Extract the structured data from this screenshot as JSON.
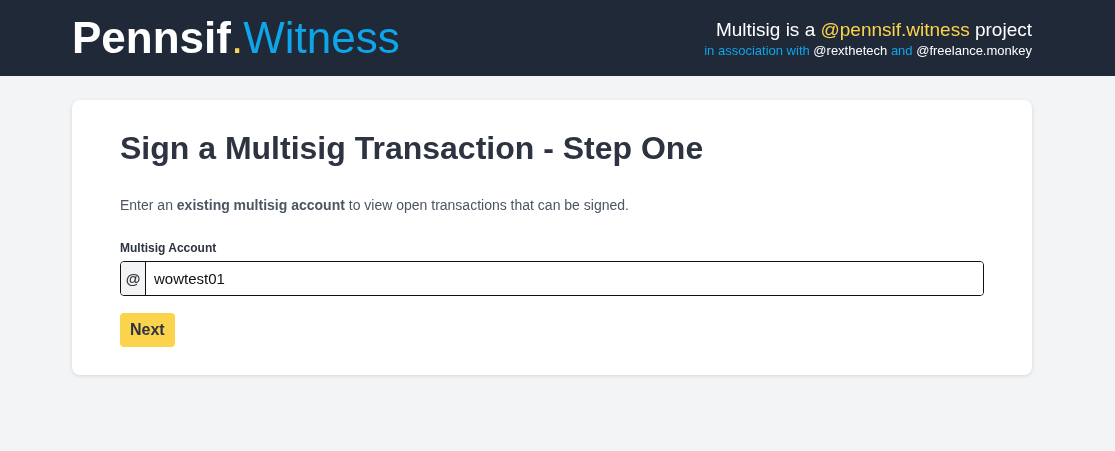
{
  "header": {
    "logo": {
      "name": "Pennsif",
      "dot": ".",
      "suffix": "Witness"
    },
    "tagline": [
      {
        "text": "Multisig is a ",
        "kind": "plain"
      },
      {
        "text": "@pennsif.witness",
        "kind": "highlight"
      },
      {
        "text": " project",
        "kind": "plain"
      }
    ],
    "credits": [
      {
        "text": "in association with ",
        "kind": "accent"
      },
      {
        "text": "@rexthetech",
        "kind": "plain"
      },
      {
        "text": " and ",
        "kind": "accent"
      },
      {
        "text": "@freelance.monkey",
        "kind": "plain"
      }
    ]
  },
  "card": {
    "title": "Sign a Multisig Transaction - Step One",
    "intro": "Enter an **existing multisig account** to view open transactions that can be signed.",
    "field": {
      "label": "Multisig Account",
      "prefix": "@",
      "value": "wowtest01"
    },
    "button": "Next"
  }
}
